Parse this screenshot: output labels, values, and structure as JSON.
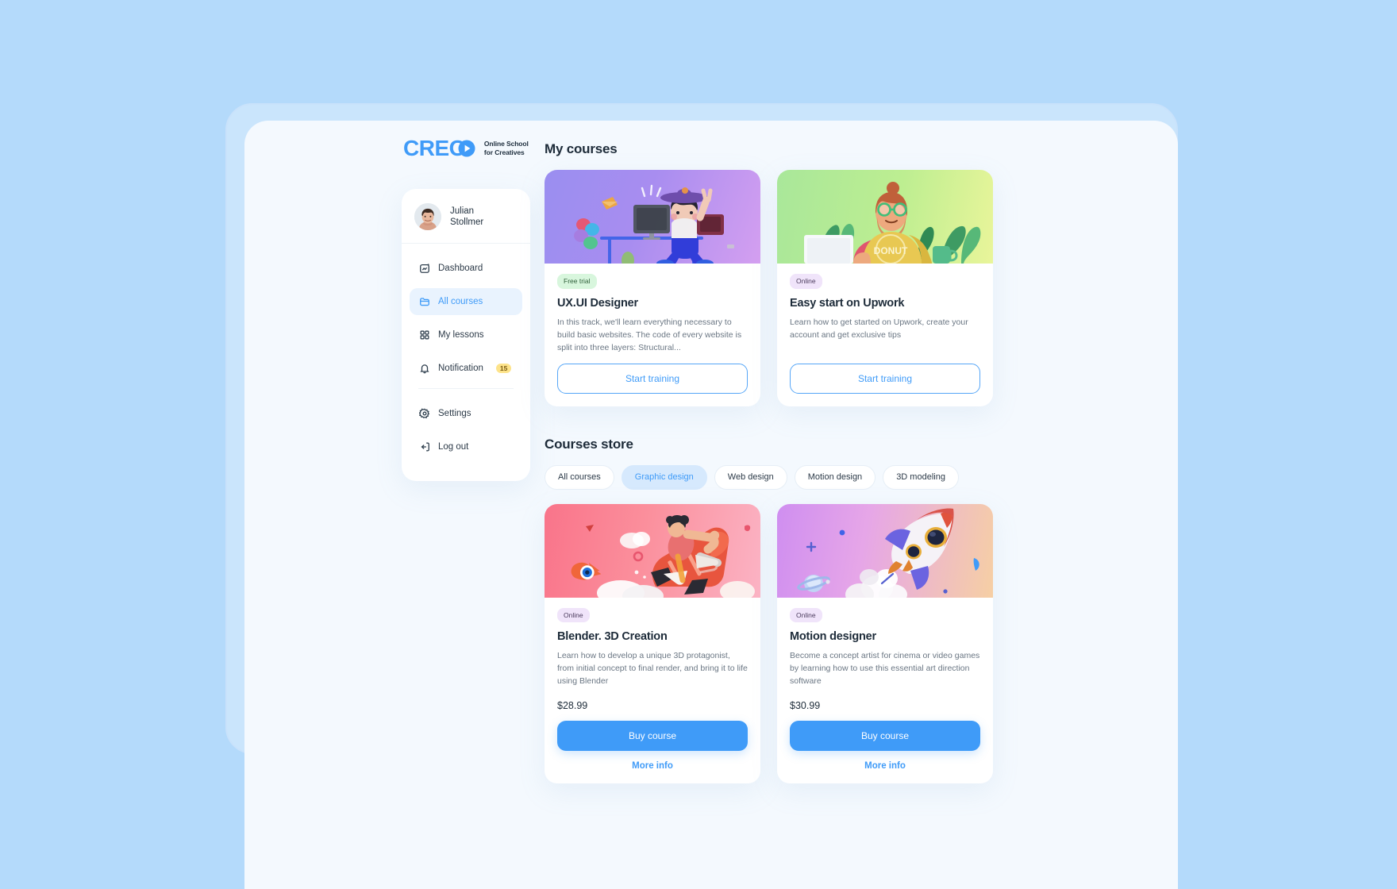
{
  "brand": {
    "logo_text": "CREO",
    "tagline_line1": "Online School",
    "tagline_line2": "for Creatives",
    "accent_color": "#3f9bf8"
  },
  "sidebar": {
    "profile": {
      "name_line1": "Julian",
      "name_line2": "Stollmer",
      "avatar_icon": "user-avatar"
    },
    "items": [
      {
        "label": "Dashboard",
        "icon": "dashboard-icon",
        "active": false
      },
      {
        "label": "All courses",
        "icon": "folder-icon",
        "active": true
      },
      {
        "label": "My lessons",
        "icon": "grid-icon",
        "active": false
      },
      {
        "label": "Notification",
        "icon": "bell-icon",
        "active": false,
        "badge": "15"
      },
      {
        "label": "Settings",
        "icon": "gear-icon",
        "active": false
      },
      {
        "label": "Log out",
        "icon": "logout-icon",
        "active": false
      }
    ]
  },
  "main": {
    "my_courses_title": "My courses",
    "courses_store_title": "Courses store",
    "my_courses": [
      {
        "badge": "Free trial",
        "badge_style": "green",
        "title": "UX.UI Designer",
        "description": "In this track, we'll learn everything necessary to build basic websites. The code of every website is split into three layers: Structural...",
        "button_label": "Start training",
        "hero_art": "desk-workspace-illustration"
      },
      {
        "badge": "Online",
        "badge_style": "purple",
        "title": "Easy start on Upwork",
        "description": "Learn how to get started on Upwork, create your account and get exclusive tips",
        "button_label": "Start training",
        "hero_art": "freelancer-laptop-illustration"
      }
    ],
    "filters": [
      {
        "label": "All courses",
        "active": false
      },
      {
        "label": "Graphic design",
        "active": true
      },
      {
        "label": "Web design",
        "active": false
      },
      {
        "label": "Motion design",
        "active": false
      },
      {
        "label": "3D modeling",
        "active": false
      }
    ],
    "store_courses": [
      {
        "badge": "Online",
        "badge_style": "purple",
        "title": "Blender. 3D Creation",
        "description": "Learn how to develop a unique 3D protagonist, from initial concept to final render, and bring it to life using Blender",
        "price": "$28.99",
        "buy_label": "Buy course",
        "more_label": "More info",
        "hero_art": "rocket-rider-illustration"
      },
      {
        "badge": "Online",
        "badge_style": "purple",
        "title": "Motion designer",
        "description": "Become a concept artist for cinema or video games by learning how to use this essential art direction software",
        "price": "$30.99",
        "buy_label": "Buy course",
        "more_label": "More info",
        "hero_art": "space-rocket-illustration"
      }
    ]
  }
}
